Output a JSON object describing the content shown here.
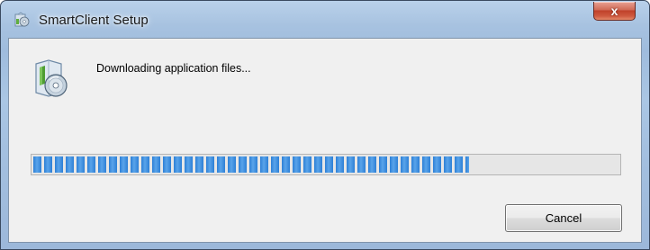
{
  "window": {
    "title": "SmartClient Setup",
    "title_icon": "setup-installer-icon",
    "close_label": "x",
    "close_icon": "close-icon"
  },
  "content": {
    "icon": "setup-installer-icon",
    "status_text": "Downloading application files..."
  },
  "progress": {
    "fraction": 0.745,
    "color": "#2c7fd6"
  },
  "buttons": {
    "cancel_label": "Cancel"
  },
  "colors": {
    "titlebar": "#a7c2e0",
    "close_button": "#c0412a",
    "dialog_background": "#f0f0f0"
  }
}
